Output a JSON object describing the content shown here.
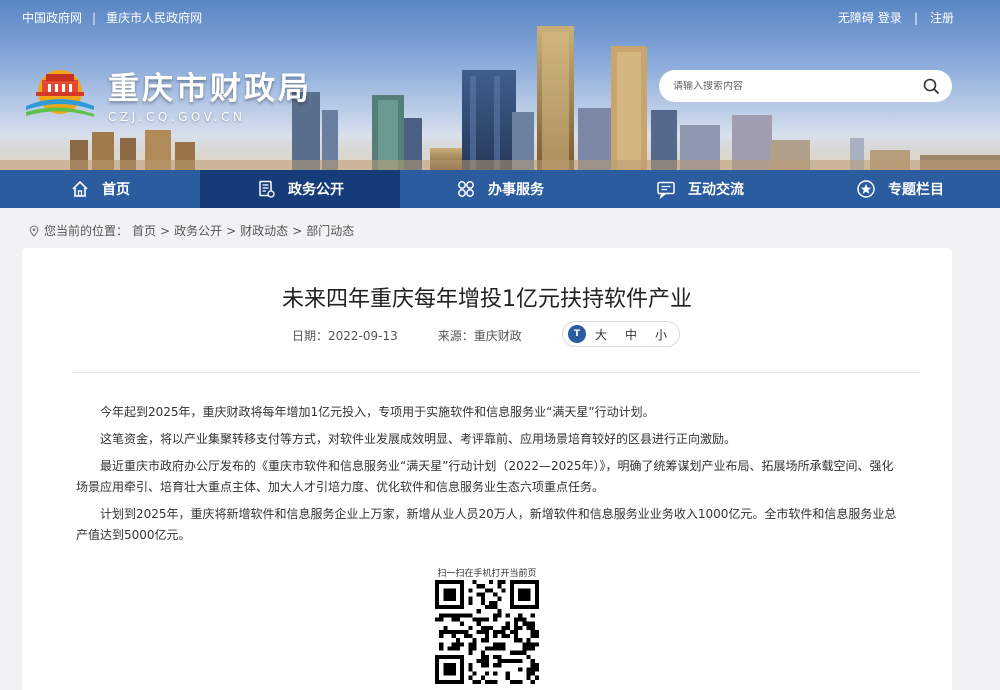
{
  "top_links": {
    "gov_site": "中国政府网",
    "city_site": "重庆市人民政府网"
  },
  "user_links": {
    "accessibility": "无障碍",
    "login": "登录",
    "register": "注册"
  },
  "logo": {
    "name": "重庆市财政局",
    "domain": "CZJ.CQ.GOV.CN"
  },
  "search": {
    "placeholder": "请输入搜索内容",
    "icon": "search-icon"
  },
  "nav": [
    {
      "label": "首页",
      "icon": "home-icon"
    },
    {
      "label": "政务公开",
      "icon": "document-icon",
      "active": true
    },
    {
      "label": "办事服务",
      "icon": "service-grid-icon"
    },
    {
      "label": "互动交流",
      "icon": "chat-icon"
    },
    {
      "label": "专题栏目",
      "icon": "star-icon"
    }
  ],
  "breadcrumb": {
    "prefix": "您当前的位置：",
    "items": [
      "首页",
      "政务公开",
      "财政动态",
      "部门动态"
    ],
    "separator": ">"
  },
  "article": {
    "title": "未来四年重庆每年增投1亿元扶持软件产业",
    "date_label": "日期：",
    "date": "2022-09-13",
    "source_label": "来源：",
    "source": "重庆财政",
    "font_size": {
      "icon_text": "T",
      "large": "大",
      "medium": "中",
      "small": "小"
    },
    "paragraphs": [
      "今年起到2025年，重庆财政将每年增加1亿元投入，专项用于实施软件和信息服务业“满天星”行动计划。",
      "这笔资金，将以产业集聚转移支付等方式，对软件业发展成效明显、考评靠前、应用场景培育较好的区县进行正向激励。",
      "最近重庆市政府办公厅发布的《重庆市软件和信息服务业“满天星”行动计划（2022—2025年）》，明确了统筹谋划产业布局、拓展场所承载空间、强化场景应用牵引、培育壮大重点主体、加大人才引培力度、优化软件和信息服务业生态六项重点任务。",
      "计划到2025年，重庆将新增软件和信息服务企业上万家，新增从业人员20万人，新增软件和信息服务业业务收入1000亿元。全市软件和信息服务业总产值达到5000亿元。"
    ],
    "qr_label": "扫一扫在手机打开当前页"
  },
  "colors": {
    "nav_bg": "#2a5c9f",
    "nav_active": "#153c78",
    "page_bg": "#f1f2f4"
  }
}
